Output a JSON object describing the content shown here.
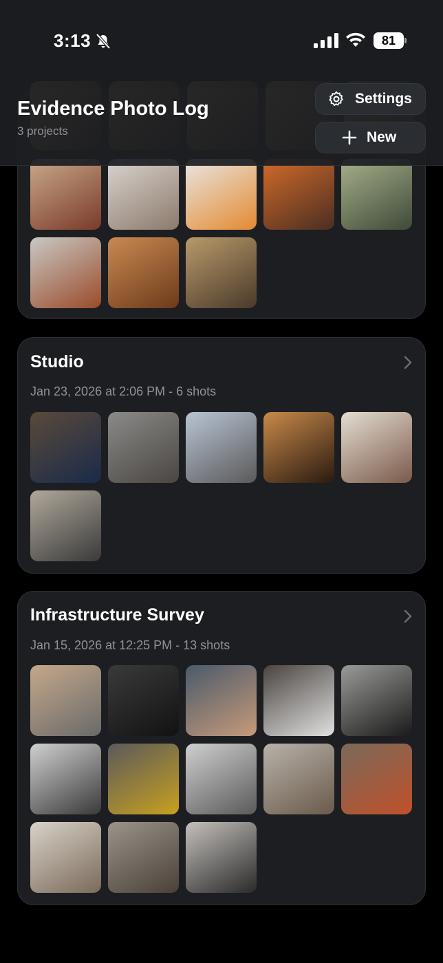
{
  "status_bar": {
    "time": "3:13",
    "battery": "81"
  },
  "header": {
    "title": "Evidence Photo Log",
    "subtitle": "3 projects",
    "settings_label": "Settings",
    "new_label": "New"
  },
  "projects": [
    {
      "name": "",
      "meta": "",
      "photos": [
        {
          "desc": "party-table",
          "c1": "#c9a98a",
          "c2": "#7a3a2a"
        },
        {
          "desc": "white-pumpkin",
          "c1": "#d9d4cf",
          "c2": "#8c7a6c"
        },
        {
          "desc": "squash-halves",
          "c1": "#e9e6e2",
          "c2": "#e38a32"
        },
        {
          "desc": "roasted-squash-tray",
          "c1": "#d36b2a",
          "c2": "#4a2e22"
        },
        {
          "desc": "grocery-shelf",
          "c1": "#a7b08a",
          "c2": "#3f4a38"
        },
        {
          "desc": "fridge-jars",
          "c1": "#c8c8c4",
          "c2": "#9a4b2a"
        },
        {
          "desc": "hummus-tub",
          "c1": "#c98a52",
          "c2": "#6c3a1a"
        },
        {
          "desc": "paella-pan",
          "c1": "#b89a6a",
          "c2": "#4a3a2a"
        }
      ]
    },
    {
      "name": "Studio",
      "meta": "Jan 23, 2026 at 2:06 PM - 6 shots",
      "photos": [
        {
          "desc": "desk-monitors",
          "c1": "#5a4a3a",
          "c2": "#1a2a4a"
        },
        {
          "desc": "stone-building",
          "c1": "#8a8a88",
          "c2": "#4a4642"
        },
        {
          "desc": "street-construction",
          "c1": "#b8c4d4",
          "c2": "#5a5a5a"
        },
        {
          "desc": "bass-guitar",
          "c1": "#c88a4a",
          "c2": "#2a1a10"
        },
        {
          "desc": "loft-workers",
          "c1": "#e4ddd2",
          "c2": "#7a5a4a"
        },
        {
          "desc": "effects-pedal",
          "c1": "#b0a89a",
          "c2": "#3a3a3a"
        }
      ]
    },
    {
      "name": "Infrastructure Survey",
      "meta": "Jan 15, 2026 at 12:25 PM - 13 shots",
      "photos": [
        {
          "desc": "wooden-booth",
          "c1": "#c4a88a",
          "c2": "#6a6a6a"
        },
        {
          "desc": "rack-cables",
          "c1": "#3a3a3a",
          "c2": "#121212"
        },
        {
          "desc": "circuit-board-hand",
          "c1": "#4a5a6a",
          "c2": "#c79a7a"
        },
        {
          "desc": "charger-cable",
          "c1": "#4a4440",
          "c2": "#e0e0e0"
        },
        {
          "desc": "robot-gripper",
          "c1": "#9a9a98",
          "c2": "#1a1a1a"
        },
        {
          "desc": "projector-device",
          "c1": "#d0d0d0",
          "c2": "#3a3a3a"
        },
        {
          "desc": "wall-device-wires",
          "c1": "#5a5a5a",
          "c2": "#c8a020"
        },
        {
          "desc": "oven-panel",
          "c1": "#cfcfcf",
          "c2": "#5a5a5a"
        },
        {
          "desc": "appliance-knob",
          "c1": "#b8b2aa",
          "c2": "#6a5a4a"
        },
        {
          "desc": "engine-part",
          "c1": "#7a6a5a",
          "c2": "#c0502a"
        },
        {
          "desc": "kitchen-room",
          "c1": "#d8d2c8",
          "c2": "#7a6a5a"
        },
        {
          "desc": "furnace-utility",
          "c1": "#9a948a",
          "c2": "#4a4038"
        },
        {
          "desc": "robot-arm",
          "c1": "#c4c0bc",
          "c2": "#2a2a2a"
        }
      ]
    }
  ]
}
